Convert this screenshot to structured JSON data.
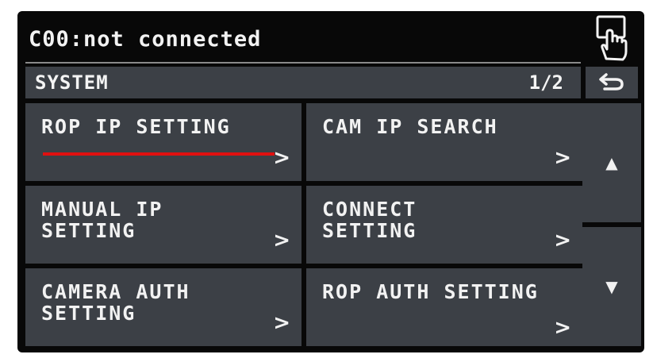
{
  "status": {
    "connection_text": "C00:not connected"
  },
  "header": {
    "title": "SYSTEM",
    "page": "1/2"
  },
  "menu": {
    "items": [
      {
        "label": "ROP IP SETTING",
        "chevron": ">"
      },
      {
        "label": "CAM IP SEARCH",
        "chevron": ">"
      },
      {
        "label": "MANUAL IP\nSETTING",
        "chevron": ">"
      },
      {
        "label": "CONNECT\nSETTING",
        "chevron": ">"
      },
      {
        "label": "CAMERA AUTH\nSETTING",
        "chevron": ">"
      },
      {
        "label": "ROP AUTH SETTING",
        "chevron": ">"
      }
    ]
  },
  "scroll": {
    "up_glyph": "▲",
    "down_glyph": "▼"
  },
  "colors": {
    "screen": "#080808",
    "tile": "#3c4046",
    "text": "#f2f2f2",
    "highlight": "#e01010"
  }
}
